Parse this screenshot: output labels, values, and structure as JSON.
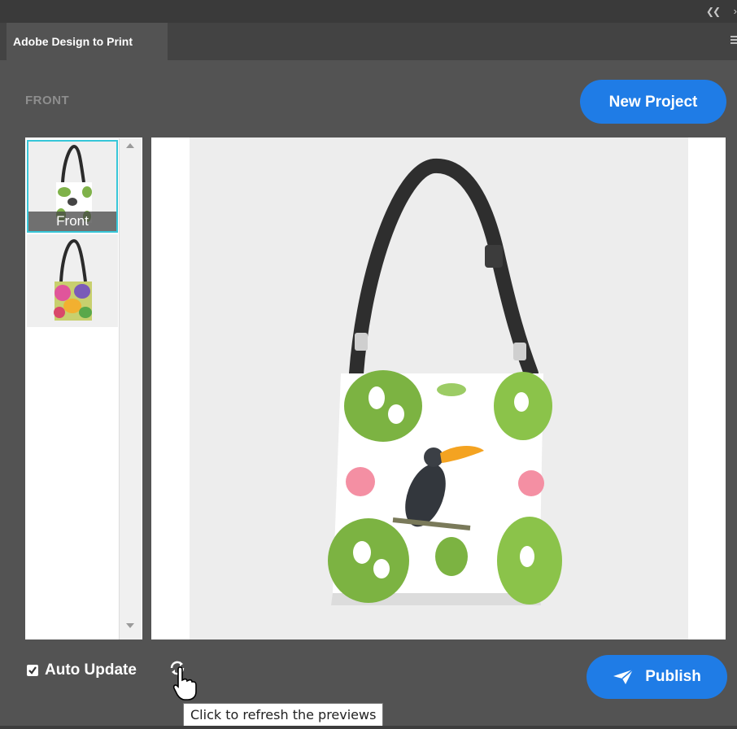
{
  "panel": {
    "tab_title": "Adobe Design to Print",
    "view_label": "FRONT",
    "new_project_label": "New Project"
  },
  "thumbnails": [
    {
      "label": "Front",
      "selected": true,
      "icon": "tote-bag-front-thumbnail"
    },
    {
      "label": "",
      "selected": false,
      "icon": "tote-bag-back-thumbnail"
    }
  ],
  "preview": {
    "icon": "tote-bag-preview-image"
  },
  "footer": {
    "auto_update_label": "Auto Update",
    "auto_update_checked": true,
    "refresh_tooltip": "Click to refresh the previews",
    "publish_label": "Publish"
  },
  "colors": {
    "accent": "#1f7ce6",
    "selection": "#37c6d8",
    "panel_bg": "#535353"
  }
}
